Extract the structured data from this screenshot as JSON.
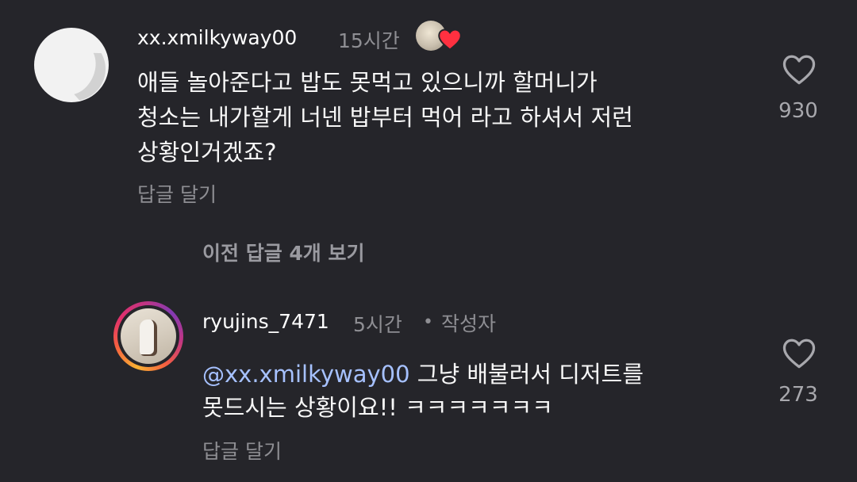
{
  "comments": [
    {
      "username": "xx.xmilkyway00",
      "time": "15시간",
      "lines": [
        "애들 놀아준다고 밥도 못먹고 있으니까 할머니가",
        "청소는 내가할게 너넨 밥부터 먹어 라고 하셔서 저런",
        "상황인거겠죠?"
      ],
      "reply_label": "답글 달기",
      "likes": "930",
      "liked_by_author": true
    },
    {
      "username": "ryujins_7471",
      "time": "5시간",
      "separator": "•",
      "author_badge": "작성자",
      "mention_symbol": "@",
      "mention": "xx.xmilkyway00",
      "line1_rest": " 그냥 배불러서 디저트를",
      "line2": "못드시는 상황이요!! ㅋㅋㅋㅋㅋㅋㅋ",
      "reply_label": "답글 달기",
      "likes": "273"
    }
  ],
  "view_previous_replies": "이전 답글 4개 보기",
  "colors": {
    "background": "#25252a",
    "text_primary": "#f5f5f5",
    "text_secondary": "#8e8e93",
    "mention": "#a6c1ff",
    "heart_red": "#ff3040"
  },
  "icons": {
    "like": "heart-outline-icon",
    "liked_by_creator": "heart-filled-icon"
  }
}
